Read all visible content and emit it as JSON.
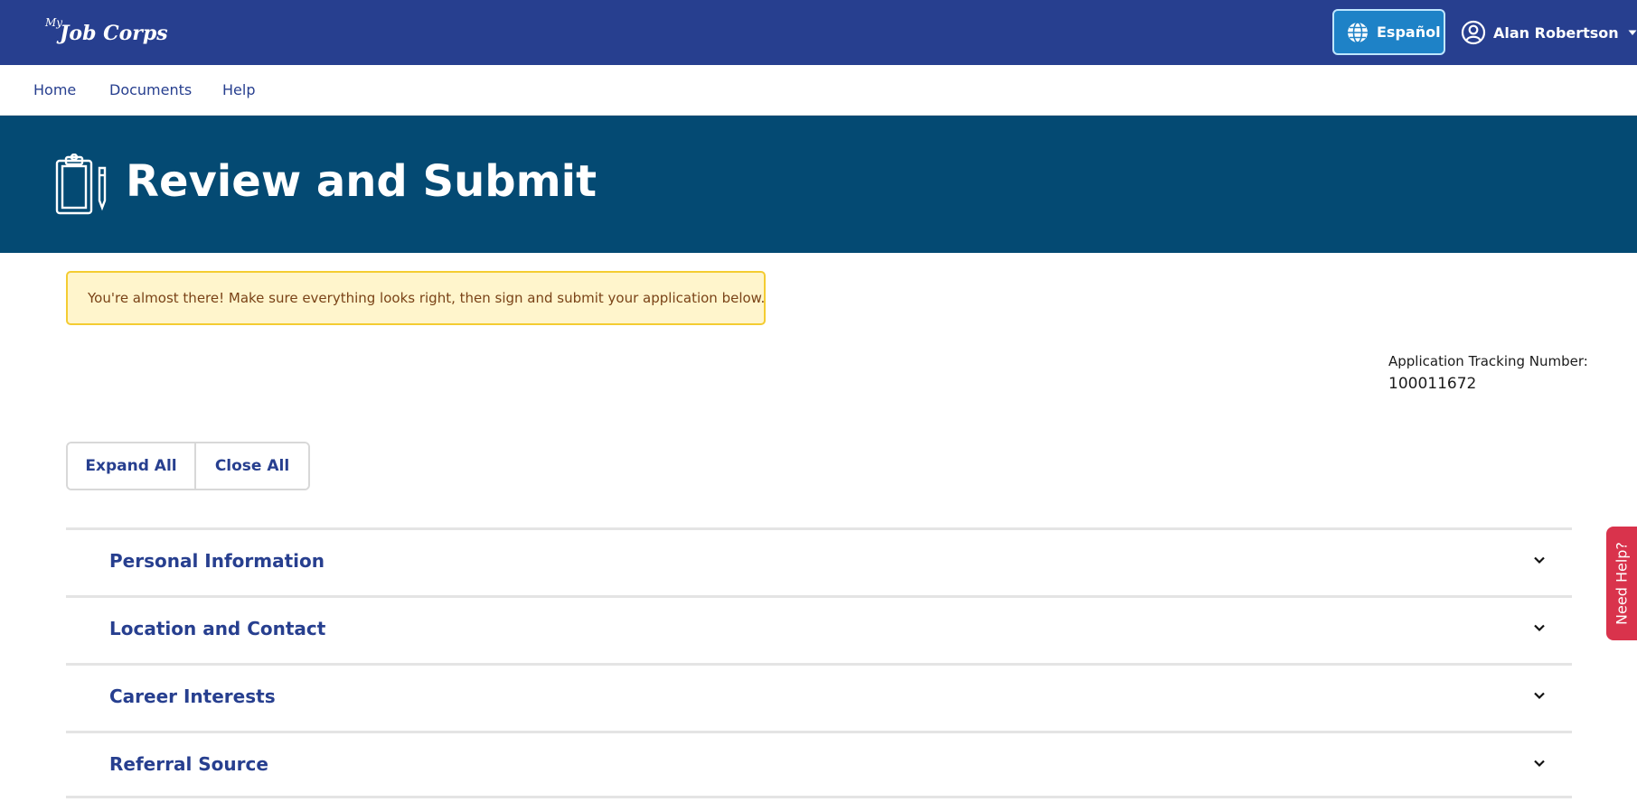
{
  "header": {
    "logo_prefix": "My",
    "logo_text": "Job Corps",
    "language_button": "Español",
    "user_name": "Alan Robertson"
  },
  "nav": {
    "items": [
      "Home",
      "Documents",
      "Help"
    ]
  },
  "page": {
    "title": "Review and Submit",
    "alert": "You're almost there! Make sure everything looks right, then sign and submit your application below.",
    "tracking_label": "Application Tracking Number:",
    "tracking_number": "100011672"
  },
  "controls": {
    "expand_all": "Expand All",
    "close_all": "Close All"
  },
  "sections": [
    {
      "label": "Personal Information"
    },
    {
      "label": "Location and Contact"
    },
    {
      "label": "Career Interests"
    },
    {
      "label": "Referral Source"
    }
  ],
  "need_help": "Need Help?",
  "colors": {
    "header_bg": "#273f8f",
    "banner_bg": "#044a73",
    "lang_button_bg": "#1e82c7",
    "alert_bg": "#fff5cc",
    "alert_border": "#f4cc32",
    "link": "#273f8f",
    "need_help_bg": "#d9334c"
  },
  "icons": {
    "language": "globe-icon",
    "user": "user-circle-icon",
    "user_menu": "caret-down-icon",
    "banner": "clipboard-pen-icon",
    "section_toggle": "chevron-down-icon"
  }
}
